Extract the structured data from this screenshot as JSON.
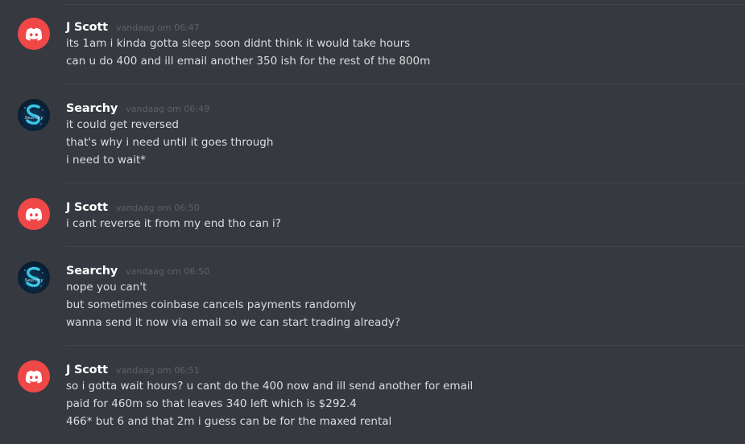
{
  "messages": [
    {
      "author": "J Scott",
      "avatar": "discord-default-avatar-icon",
      "timestamp": "vandaag om 06:47",
      "lines": [
        "its 1am i kinda gotta sleep soon didnt think it would take hours",
        "can u do 400 and ill email another 350 ish for the rest of the 800m"
      ]
    },
    {
      "author": "Searchy",
      "avatar": "searchy-avatar-icon",
      "timestamp": "vandaag om 06:49",
      "lines": [
        "it could get reversed",
        "that's why i need until it goes through",
        "i need to wait*"
      ]
    },
    {
      "author": "J Scott",
      "avatar": "discord-default-avatar-icon",
      "timestamp": "vandaag om 06:50",
      "lines": [
        "i cant reverse it from my end tho can i?"
      ]
    },
    {
      "author": "Searchy",
      "avatar": "searchy-avatar-icon",
      "timestamp": "vandaag om 06:50",
      "lines": [
        "nope you can't",
        "but sometimes coinbase cancels payments randomly",
        "wanna send it now via email so we can start trading already?"
      ]
    },
    {
      "author": "J Scott",
      "avatar": "discord-default-avatar-icon",
      "timestamp": "vandaag om 06:51",
      "lines": [
        "so i gotta wait hours? u cant do the 400 now and ill send another for email",
        "paid for 460m so that leaves 340 left which is $292.4",
        "466* but 6 and that 2m i guess can be for the maxed rental"
      ]
    }
  ],
  "colors": {
    "background": "#36393f",
    "discord_avatar": "#f04747",
    "username": "#ffffff",
    "text": "#dcddde",
    "timestamp": "#5d6169"
  }
}
